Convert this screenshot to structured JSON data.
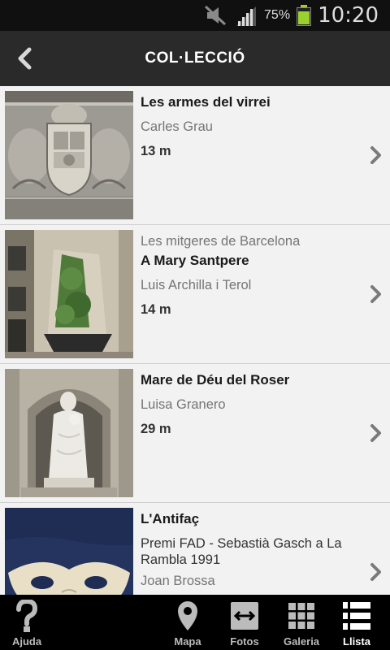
{
  "status_bar": {
    "battery": "75%",
    "battery_level": 0.75,
    "time": "10:20"
  },
  "header": {
    "title": "COL·LECCIÓ"
  },
  "items": [
    {
      "name": "Les armes del virrei",
      "author": "Carles Grau",
      "distance": "13 m"
    },
    {
      "subtitle": "Les mitgeres de Barcelona",
      "name": "A Mary Santpere",
      "author": "Luis Archilla i Terol",
      "distance": "14 m"
    },
    {
      "name": "Mare de Déu del Roser",
      "author": "Luisa Granero",
      "distance": "29 m"
    },
    {
      "name": "L'Antifaç",
      "award": "Premi FAD - Sebastià Gasch a La Rambla 1991",
      "author": "Joan Brossa"
    }
  ],
  "tabs": [
    {
      "label": "Ajuda",
      "icon": "question-icon"
    },
    {
      "label": "Mapa",
      "icon": "map-pin-icon"
    },
    {
      "label": "Fotos",
      "icon": "arrows-icon"
    },
    {
      "label": "Galeria",
      "icon": "grid-icon"
    },
    {
      "label": "Llista",
      "icon": "list-icon",
      "active": true
    }
  ]
}
